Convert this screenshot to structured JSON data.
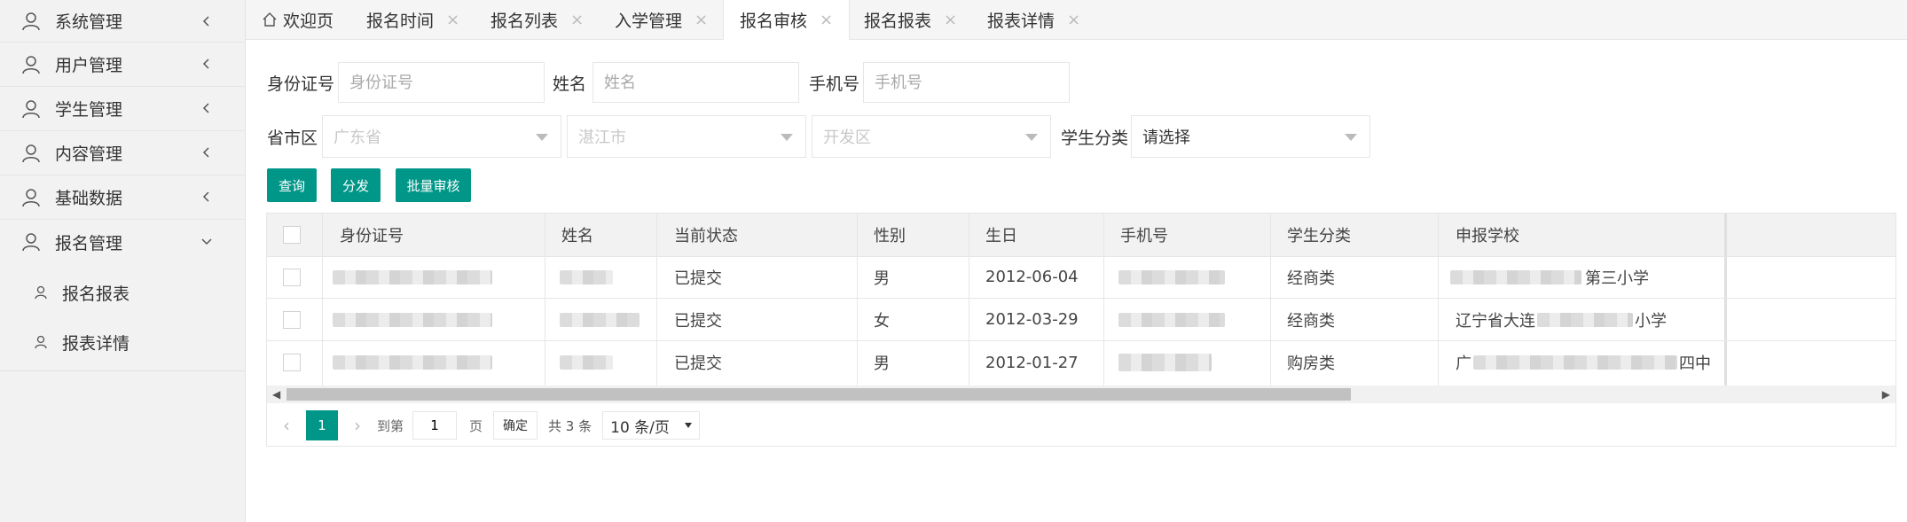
{
  "sidebar": {
    "items": [
      {
        "label": "系统管理",
        "icon": "user-icon",
        "chevron": "chevron-left-icon"
      },
      {
        "label": "用户管理",
        "icon": "user-icon",
        "chevron": "chevron-left-icon"
      },
      {
        "label": "学生管理",
        "icon": "user-icon",
        "chevron": "chevron-left-icon"
      },
      {
        "label": "内容管理",
        "icon": "user-icon",
        "chevron": "chevron-left-icon"
      },
      {
        "label": "基础数据",
        "icon": "user-icon",
        "chevron": "chevron-left-icon"
      },
      {
        "label": "报名管理",
        "icon": "user-icon",
        "chevron": "chevron-down-icon"
      }
    ],
    "subitems": [
      {
        "label": "报名报表",
        "icon": "user-icon"
      },
      {
        "label": "报表详情",
        "icon": "user-icon"
      }
    ]
  },
  "tabs": [
    {
      "label": "欢迎页",
      "icon": "home-icon",
      "closable": false
    },
    {
      "label": "报名时间",
      "closable": true
    },
    {
      "label": "报名列表",
      "closable": true
    },
    {
      "label": "入学管理",
      "closable": true
    },
    {
      "label": "报名审核",
      "closable": true,
      "active": true
    },
    {
      "label": "报名报表",
      "closable": true
    },
    {
      "label": "报表详情",
      "closable": true
    }
  ],
  "tab_close": "×",
  "form": {
    "id_label": "身份证号",
    "id_placeholder": "身份证号",
    "name_label": "姓名",
    "name_placeholder": "姓名",
    "phone_label": "手机号",
    "phone_placeholder": "手机号",
    "region_label": "省市区",
    "province": "广东省",
    "city": "湛江市",
    "district": "开发区",
    "category_label": "学生分类",
    "category_value": "请选择"
  },
  "buttons": {
    "query": "查询",
    "distribute": "分发",
    "batch_review": "批量审核"
  },
  "table": {
    "headers": [
      "身份证号",
      "姓名",
      "当前状态",
      "性别",
      "生日",
      "手机号",
      "学生分类",
      "申报学校"
    ],
    "rows": [
      {
        "status": "已提交",
        "gender": "男",
        "birthday": "2012-06-04",
        "category": "经商类",
        "school_visible": "第三小学"
      },
      {
        "status": "已提交",
        "gender": "女",
        "birthday": "2012-03-29",
        "category": "经商类",
        "school_prefix": "辽宁省大连",
        "school_suffix": "小学"
      },
      {
        "status": "已提交",
        "gender": "男",
        "birthday": "2012-01-27",
        "category": "购房类",
        "school_prefix": "广",
        "school_suffix": "四中"
      }
    ]
  },
  "pager": {
    "current_page": "1",
    "goto_label": "到第",
    "goto_value": "1",
    "page_unit": "页",
    "confirm": "确定",
    "total": "共 3 条",
    "page_size": "10 条/页"
  },
  "colors": {
    "accent": "#009688",
    "sidebar_bg": "#f2f2f2",
    "table_header_bg": "#f2f2f2"
  }
}
